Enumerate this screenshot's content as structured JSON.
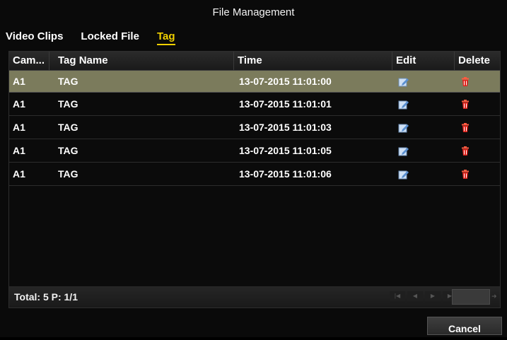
{
  "window": {
    "title": "File Management"
  },
  "tabs": [
    {
      "label": "Video Clips",
      "active": false
    },
    {
      "label": "Locked File",
      "active": false
    },
    {
      "label": "Tag",
      "active": true
    }
  ],
  "table": {
    "columns": [
      "Cam...",
      "Tag Name",
      "Time",
      "Edit",
      "Delete"
    ],
    "rows": [
      {
        "cam": "A1",
        "tag": "TAG",
        "time": "13-07-2015 11:01:00",
        "selected": true
      },
      {
        "cam": "A1",
        "tag": "TAG",
        "time": "13-07-2015 11:01:01",
        "selected": false
      },
      {
        "cam": "A1",
        "tag": "TAG",
        "time": "13-07-2015 11:01:03",
        "selected": false
      },
      {
        "cam": "A1",
        "tag": "TAG",
        "time": "13-07-2015 11:01:05",
        "selected": false
      },
      {
        "cam": "A1",
        "tag": "TAG",
        "time": "13-07-2015 11:01:06",
        "selected": false
      }
    ],
    "edit_icon": "edit-pencil-icon",
    "delete_icon": "trash-icon"
  },
  "footer": {
    "total_label": "Total: 5 P: 1/1",
    "pager_icons": [
      "first-page-icon",
      "prev-page-icon",
      "next-page-icon",
      "last-page-icon"
    ],
    "go_icon": "go-arrow-icon"
  },
  "actions": {
    "cancel_label": "Cancel"
  },
  "colors": {
    "accent_tab": "#f0d000",
    "selected_row": "#7b7b5c",
    "delete_red": "#e0201a",
    "edit_blue": "#5a8fd0"
  }
}
